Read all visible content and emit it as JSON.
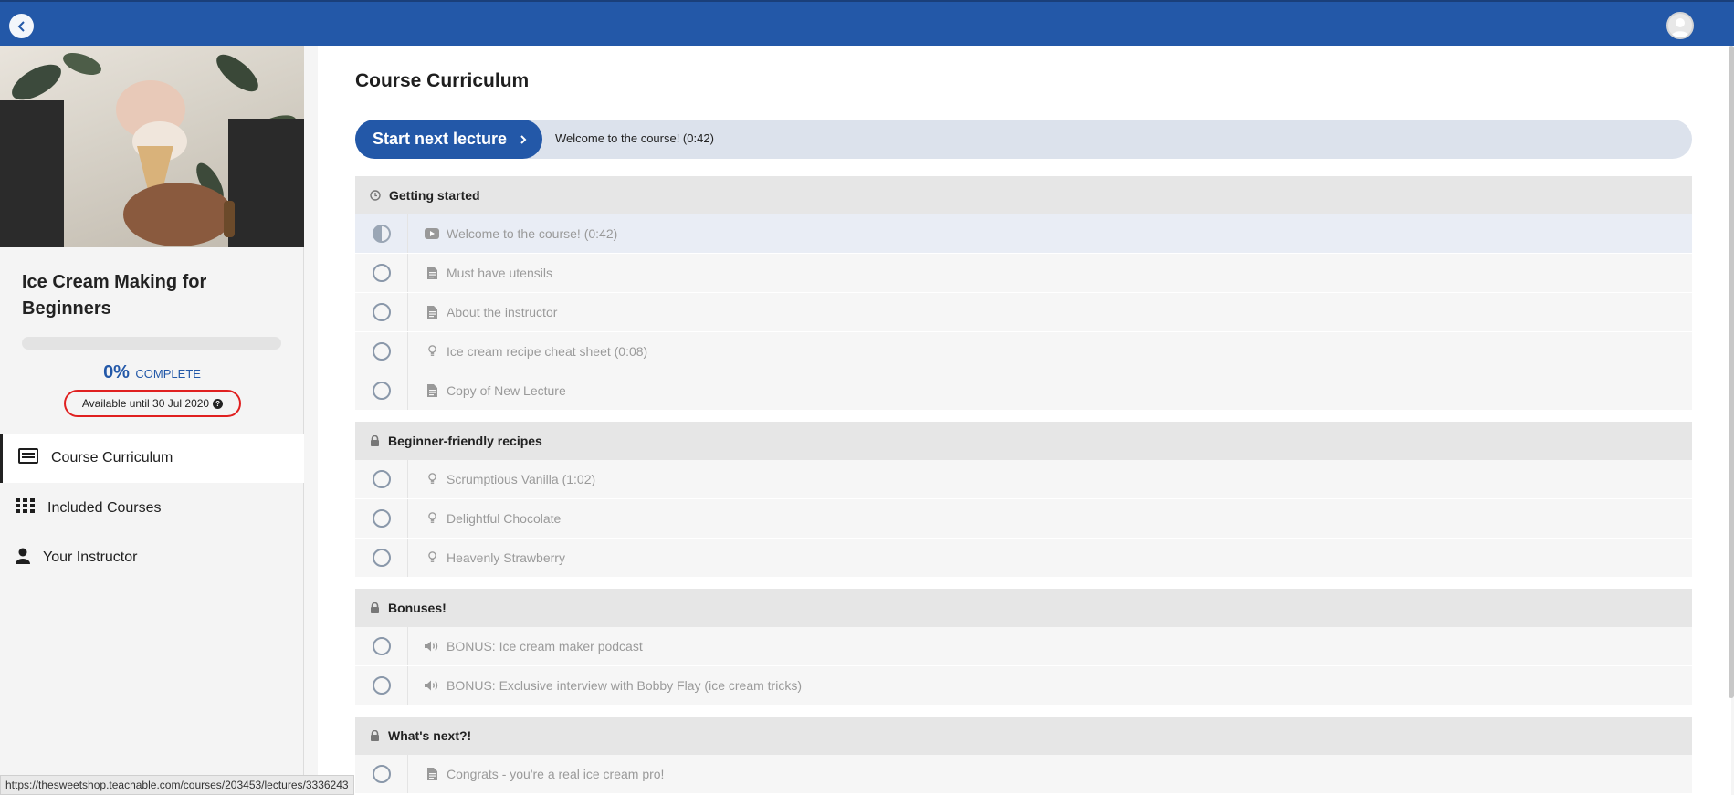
{
  "sidebar": {
    "course_title": "Ice Cream Making for Beginners",
    "progress": {
      "percent": 0,
      "percent_label": "0%",
      "complete_label": "COMPLETE"
    },
    "availability": "Available until 30 Jul 2020",
    "nav": [
      {
        "label": "Course Curriculum",
        "icon": "curriculum-icon",
        "active": true
      },
      {
        "label": "Included Courses",
        "icon": "grid-icon",
        "active": false
      },
      {
        "label": "Your Instructor",
        "icon": "user-icon",
        "active": false
      }
    ]
  },
  "main": {
    "title": "Course Curriculum",
    "start_button": "Start next lecture",
    "next_lecture": "Welcome to the course! (0:42)",
    "sections": [
      {
        "title": "Getting started",
        "icon": "clock-icon",
        "lectures": [
          {
            "title": "Welcome to the course! (0:42)",
            "type": "video-icon",
            "status": "in-progress"
          },
          {
            "title": "Must have utensils",
            "type": "document-icon",
            "status": "incomplete"
          },
          {
            "title": "About the instructor",
            "type": "document-icon",
            "status": "incomplete"
          },
          {
            "title": "Ice cream recipe cheat sheet (0:08)",
            "type": "lightbulb-icon",
            "status": "incomplete"
          },
          {
            "title": "Copy of New Lecture",
            "type": "document-icon",
            "status": "incomplete"
          }
        ]
      },
      {
        "title": "Beginner-friendly recipes",
        "icon": "lock-icon",
        "lectures": [
          {
            "title": "Scrumptious Vanilla (1:02)",
            "type": "lightbulb-icon",
            "status": "incomplete"
          },
          {
            "title": "Delightful Chocolate",
            "type": "lightbulb-icon",
            "status": "incomplete"
          },
          {
            "title": "Heavenly Strawberry",
            "type": "lightbulb-icon",
            "status": "incomplete"
          }
        ]
      },
      {
        "title": "Bonuses!",
        "icon": "lock-icon",
        "lectures": [
          {
            "title": "BONUS: Ice cream maker podcast",
            "type": "audio-icon",
            "status": "incomplete"
          },
          {
            "title": "BONUS: Exclusive interview with Bobby Flay (ice cream tricks)",
            "type": "audio-icon",
            "status": "incomplete"
          }
        ]
      },
      {
        "title": "What's next?!",
        "icon": "lock-icon",
        "lectures": [
          {
            "title": "Congrats - you're a real ice cream pro!",
            "type": "document-icon",
            "status": "incomplete"
          }
        ]
      }
    ]
  },
  "statusbar": {
    "url": "https://thesweetshop.teachable.com/courses/203453/lectures/3336243"
  },
  "colors": {
    "brand": "#2358a8",
    "highlight": "#e02020"
  }
}
